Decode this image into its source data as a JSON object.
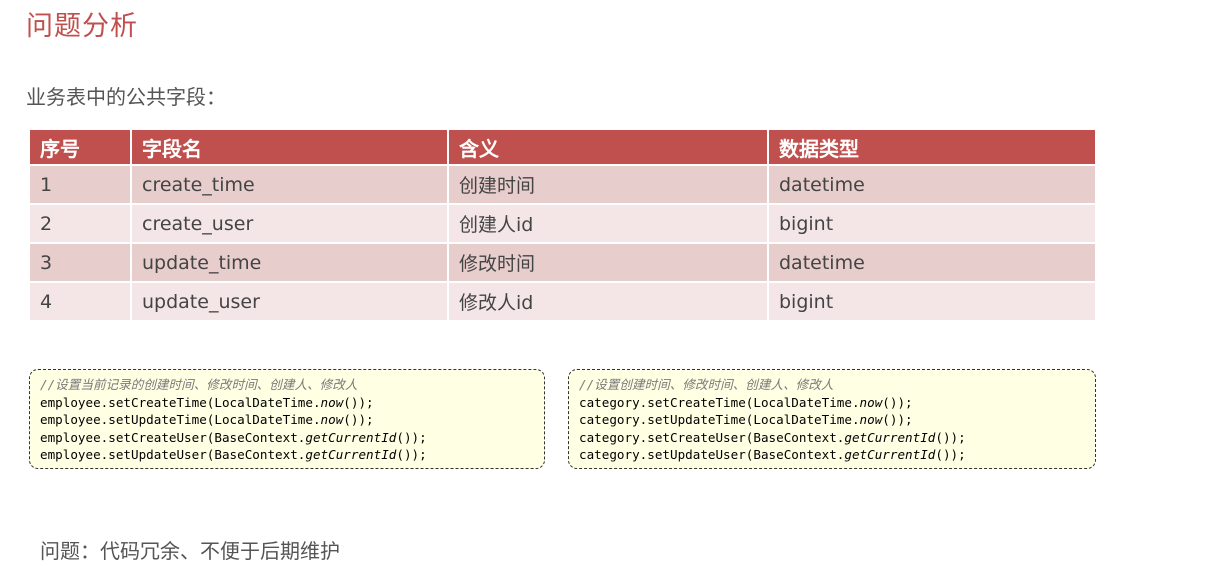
{
  "title": "问题分析",
  "subtitle": "业务表中的公共字段：",
  "table": {
    "headers": [
      "序号",
      "字段名",
      "含义",
      "数据类型"
    ],
    "rows": [
      [
        "1",
        "create_time",
        "创建时间",
        "datetime"
      ],
      [
        "2",
        "create_user",
        "创建人id",
        "bigint"
      ],
      [
        "3",
        "update_time",
        "修改时间",
        "datetime"
      ],
      [
        "4",
        "update_user",
        "修改人id",
        "bigint"
      ]
    ]
  },
  "code_left": {
    "comment": "//设置当前记录的创建时间、修改时间、创建人、修改人",
    "lines": [
      {
        "prefix": "employee.setCreateTime(LocalDateTime.",
        "ital": "now",
        "suffix": "());"
      },
      {
        "prefix": "employee.setUpdateTime(LocalDateTime.",
        "ital": "now",
        "suffix": "());"
      },
      {
        "prefix": "employee.setCreateUser(BaseContext.",
        "ital": "getCurrentId",
        "suffix": "());"
      },
      {
        "prefix": "employee.setUpdateUser(BaseContext.",
        "ital": "getCurrentId",
        "suffix": "());"
      }
    ]
  },
  "code_right": {
    "comment": "//设置创建时间、修改时间、创建人、修改人",
    "lines": [
      {
        "prefix": "category.setCreateTime(LocalDateTime.",
        "ital": "now",
        "suffix": "());"
      },
      {
        "prefix": "category.setUpdateTime(LocalDateTime.",
        "ital": "now",
        "suffix": "());"
      },
      {
        "prefix": "category.setCreateUser(BaseContext.",
        "ital": "getCurrentId",
        "suffix": "());"
      },
      {
        "prefix": "category.setUpdateUser(BaseContext.",
        "ital": "getCurrentId",
        "suffix": "());"
      }
    ]
  },
  "problem": "问题：代码冗余、不便于后期维护",
  "colors": {
    "accent": "#c0504d",
    "row_odd": "#e8cdcd",
    "row_even": "#f4e6e6",
    "code_bg": "#ffffe3"
  }
}
